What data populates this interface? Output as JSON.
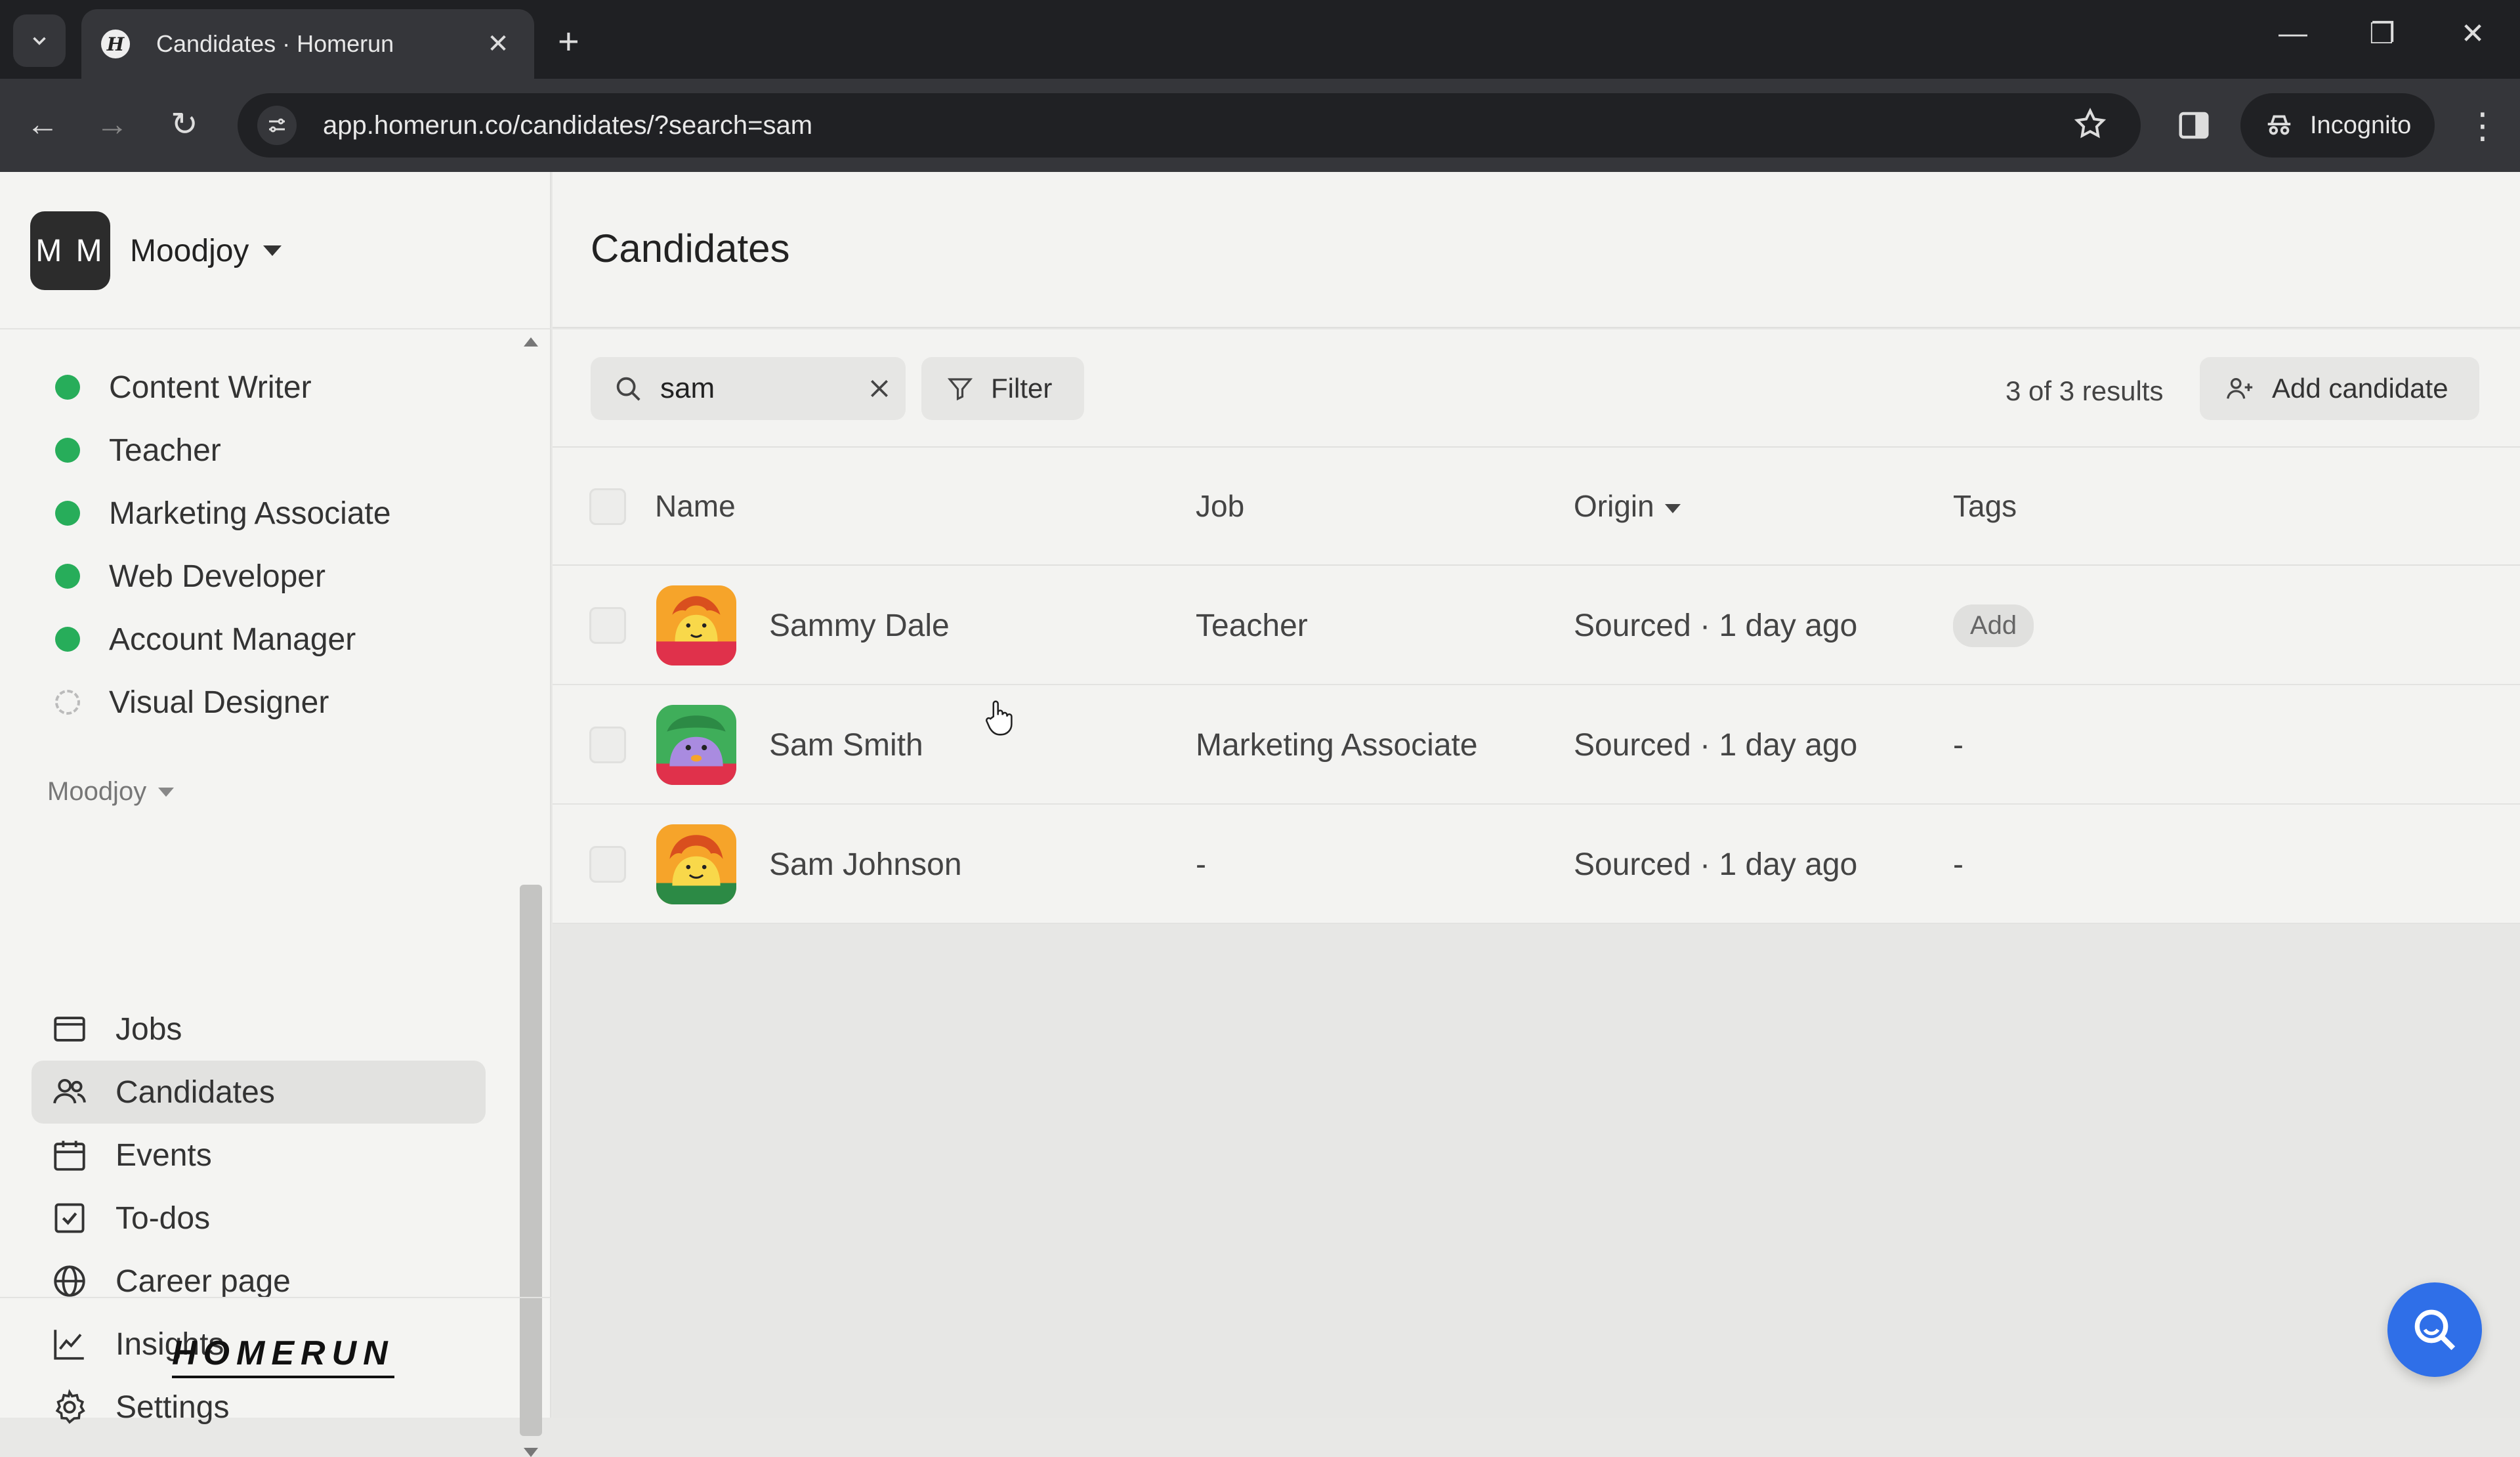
{
  "browser": {
    "tab_title": "Candidates · Homerun",
    "tab_favicon_letter": "H",
    "url": "app.homerun.co/candidates/?search=sam",
    "incognito_label": "Incognito"
  },
  "sidebar": {
    "workspace_initials": "M M",
    "workspace_name": "Moodjoy",
    "jobs": [
      {
        "label": "Content Writer",
        "status": "published"
      },
      {
        "label": "Teacher",
        "status": "published"
      },
      {
        "label": "Marketing Associate",
        "status": "published"
      },
      {
        "label": "Web Developer",
        "status": "published"
      },
      {
        "label": "Account Manager",
        "status": "published"
      },
      {
        "label": "Visual Designer",
        "status": "draft"
      }
    ],
    "section_label": "Moodjoy",
    "nav": [
      {
        "label": "Jobs",
        "icon": "briefcase-icon"
      },
      {
        "label": "Candidates",
        "icon": "people-icon",
        "active": true
      },
      {
        "label": "Events",
        "icon": "calendar-icon"
      },
      {
        "label": "To-dos",
        "icon": "checkbox-icon"
      },
      {
        "label": "Career page",
        "icon": "globe-icon"
      },
      {
        "label": "Insights",
        "icon": "chart-icon"
      },
      {
        "label": "Settings",
        "icon": "gear-icon"
      }
    ],
    "brand": "HOMERUN"
  },
  "main": {
    "title": "Candidates",
    "search_value": "sam",
    "filter_label": "Filter",
    "results_count": "3 of 3 results",
    "add_candidate_label": "Add candidate",
    "columns": {
      "name": "Name",
      "job": "Job",
      "origin": "Origin",
      "tags": "Tags"
    },
    "rows": [
      {
        "name": "Sammy Dale",
        "job": "Teacher",
        "origin": "Sourced · 1 day ago",
        "tags": "Add",
        "tags_is_button": true
      },
      {
        "name": "Sam Smith",
        "job": "Marketing Associate",
        "origin": "Sourced · 1 day ago",
        "tags": "-",
        "tags_is_button": false
      },
      {
        "name": "Sam Johnson",
        "job": "-",
        "origin": "Sourced · 1 day ago",
        "tags": "-",
        "tags_is_button": false
      }
    ]
  },
  "colors": {
    "accent_green": "#27ad5a",
    "help_blue": "#2f6fe8"
  }
}
